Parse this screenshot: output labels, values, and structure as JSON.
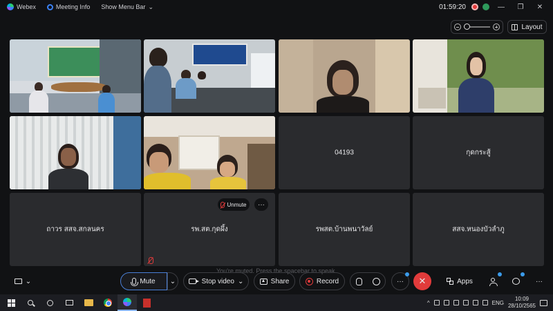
{
  "titlebar": {
    "app_name": "Webex",
    "meeting_info": "Meeting Info",
    "show_menu_bar": "Show Menu Bar",
    "elapsed_time": "01:59:20",
    "minimize": "—",
    "restore": "❐",
    "close": "✕"
  },
  "top_controls": {
    "layout_label": "Layout"
  },
  "tiles": [
    {
      "id": "tile-1",
      "name": "",
      "type": "video"
    },
    {
      "id": "tile-2",
      "name": "",
      "type": "video"
    },
    {
      "id": "tile-3",
      "name": "",
      "type": "video"
    },
    {
      "id": "tile-4",
      "name": "",
      "type": "video"
    },
    {
      "id": "tile-5",
      "name": "",
      "type": "video"
    },
    {
      "id": "tile-6",
      "name": "",
      "type": "video"
    },
    {
      "id": "tile-7",
      "name": "04193",
      "type": "name"
    },
    {
      "id": "tile-8",
      "name": "กุดกระสู้",
      "type": "name"
    },
    {
      "id": "tile-9",
      "name": "ถาวร สสจ.สกลนคร",
      "type": "name"
    },
    {
      "id": "tile-10",
      "name": "รพ.สต.กุดผึ้ง",
      "type": "name"
    },
    {
      "id": "tile-11",
      "name": "รพสต.บ้านพนาวัลย์",
      "type": "name"
    },
    {
      "id": "tile-12",
      "name": "สสจ.หนองบัวลำภู",
      "type": "name"
    }
  ],
  "tile_hover": {
    "unmute_label": "Unmute",
    "more_label": "···"
  },
  "hint_text": "You're muted. Press the spacebar to speak.",
  "controls": {
    "mute_label": "Mute",
    "caret": "⌄",
    "stop_video_label": "Stop video",
    "share_label": "Share",
    "record_label": "Record",
    "more_label": "···",
    "end_label": "✕",
    "apps_label": "Apps",
    "overflow_label": "···",
    "cc_caret": "⌄"
  },
  "taskbar": {
    "language": "ENG",
    "time": "10:09",
    "date": "28/10/2565",
    "tray_arrow": "^"
  },
  "colors": {
    "background": "#111214",
    "tile": "#2a2b2e",
    "accent": "#4a7fd6",
    "danger": "#e23b3b",
    "badge": "#3b9bea"
  }
}
